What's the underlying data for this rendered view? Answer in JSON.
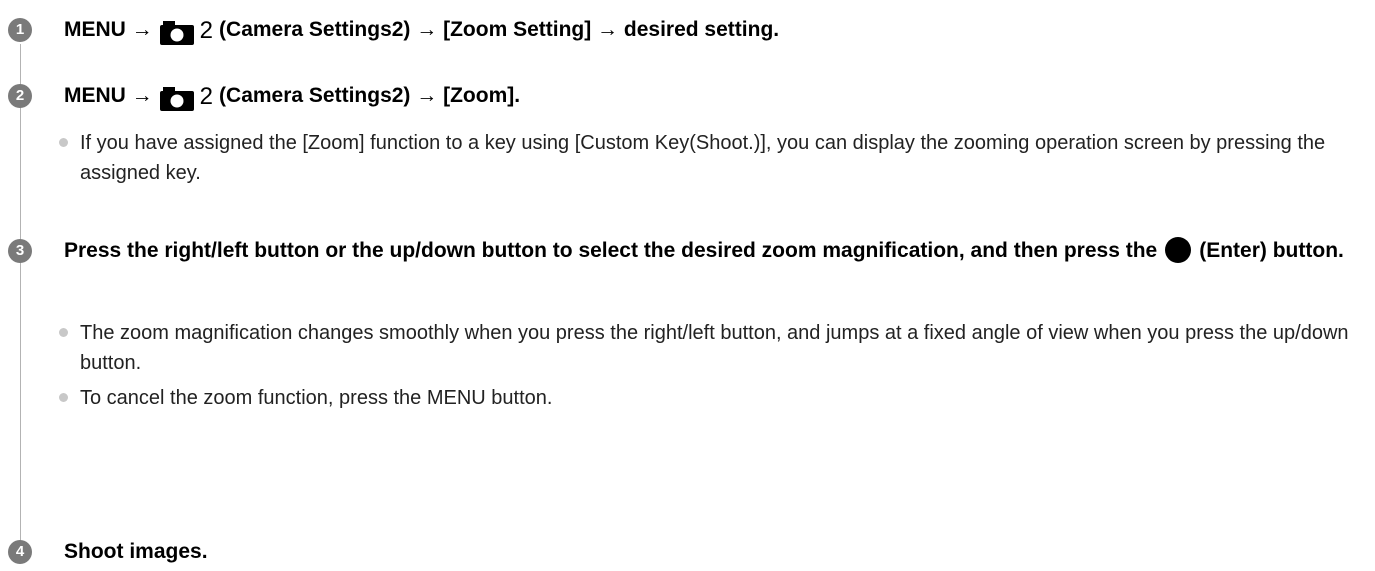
{
  "steps": [
    {
      "number": "1",
      "title_prefix": "MENU →",
      "icon_number": "2",
      "title_suffix": "(Camera Settings2) → [Zoom Setting] → desired setting."
    },
    {
      "number": "2",
      "title_prefix": "MENU →",
      "icon_number": "2",
      "title_suffix": "(Camera Settings2) → [Zoom].",
      "bullets": [
        "If you have assigned the [Zoom] function to a key using [Custom Key(Shoot.)], you can display the zooming operation screen by pressing the assigned key."
      ]
    },
    {
      "number": "3",
      "title_prefix": "Press the right/left button or the up/down button to select the desired zoom magnification, and then press the",
      "title_suffix": "(Enter) button.",
      "bullets": [
        "The zoom magnification changes smoothly when you press the right/left button, and jumps at a fixed angle of view when you press the up/down button.",
        "To cancel the zoom function, press the MENU button."
      ]
    },
    {
      "number": "4",
      "title": "Shoot images."
    }
  ],
  "icons": {
    "camera": "camera-settings-icon",
    "enter": "enter-button-icon"
  },
  "colors": {
    "step_circle": "#7a7a7a",
    "bullet_dot": "#c8c8c8",
    "timeline": "#b3b3b3"
  }
}
